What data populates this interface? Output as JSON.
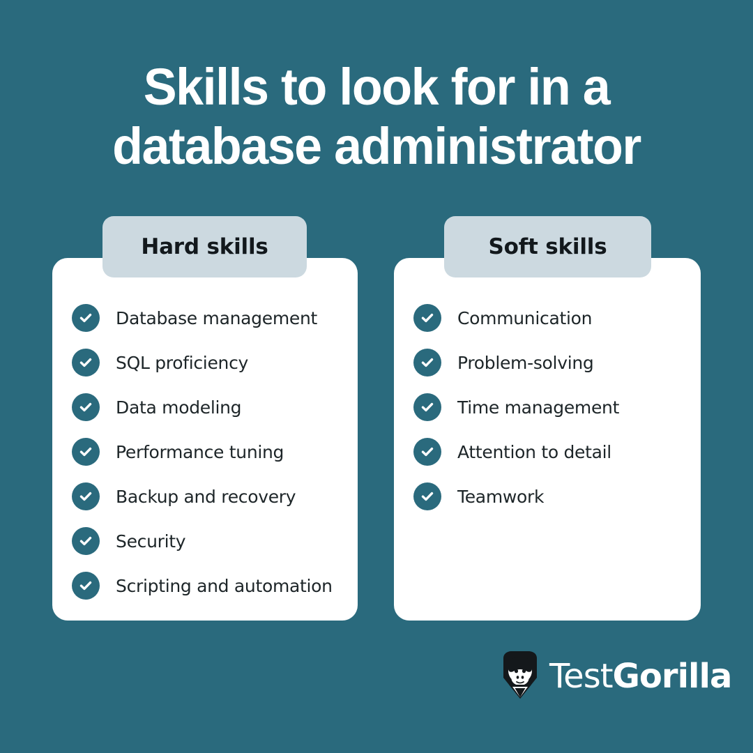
{
  "colors": {
    "background": "#2a6a7d",
    "card": "#ffffff",
    "tab": "#ccd9e0",
    "accent": "#2a6a7d",
    "title_text": "#ffffff",
    "body_text": "#1d2528",
    "tab_text": "#12181c"
  },
  "title": {
    "line1": "Skills to look for in a",
    "line2": "database administrator"
  },
  "columns": [
    {
      "tab_label": "Hard skills",
      "items": [
        "Database management",
        "SQL proficiency",
        "Data modeling",
        "Performance tuning",
        "Backup and recovery",
        "Security",
        "Scripting and automation"
      ]
    },
    {
      "tab_label": "Soft skills",
      "items": [
        "Communication",
        "Problem-solving",
        "Time management",
        "Attention to detail",
        "Teamwork"
      ]
    }
  ],
  "logo": {
    "text_light": "Test",
    "text_bold": "Gorilla"
  }
}
